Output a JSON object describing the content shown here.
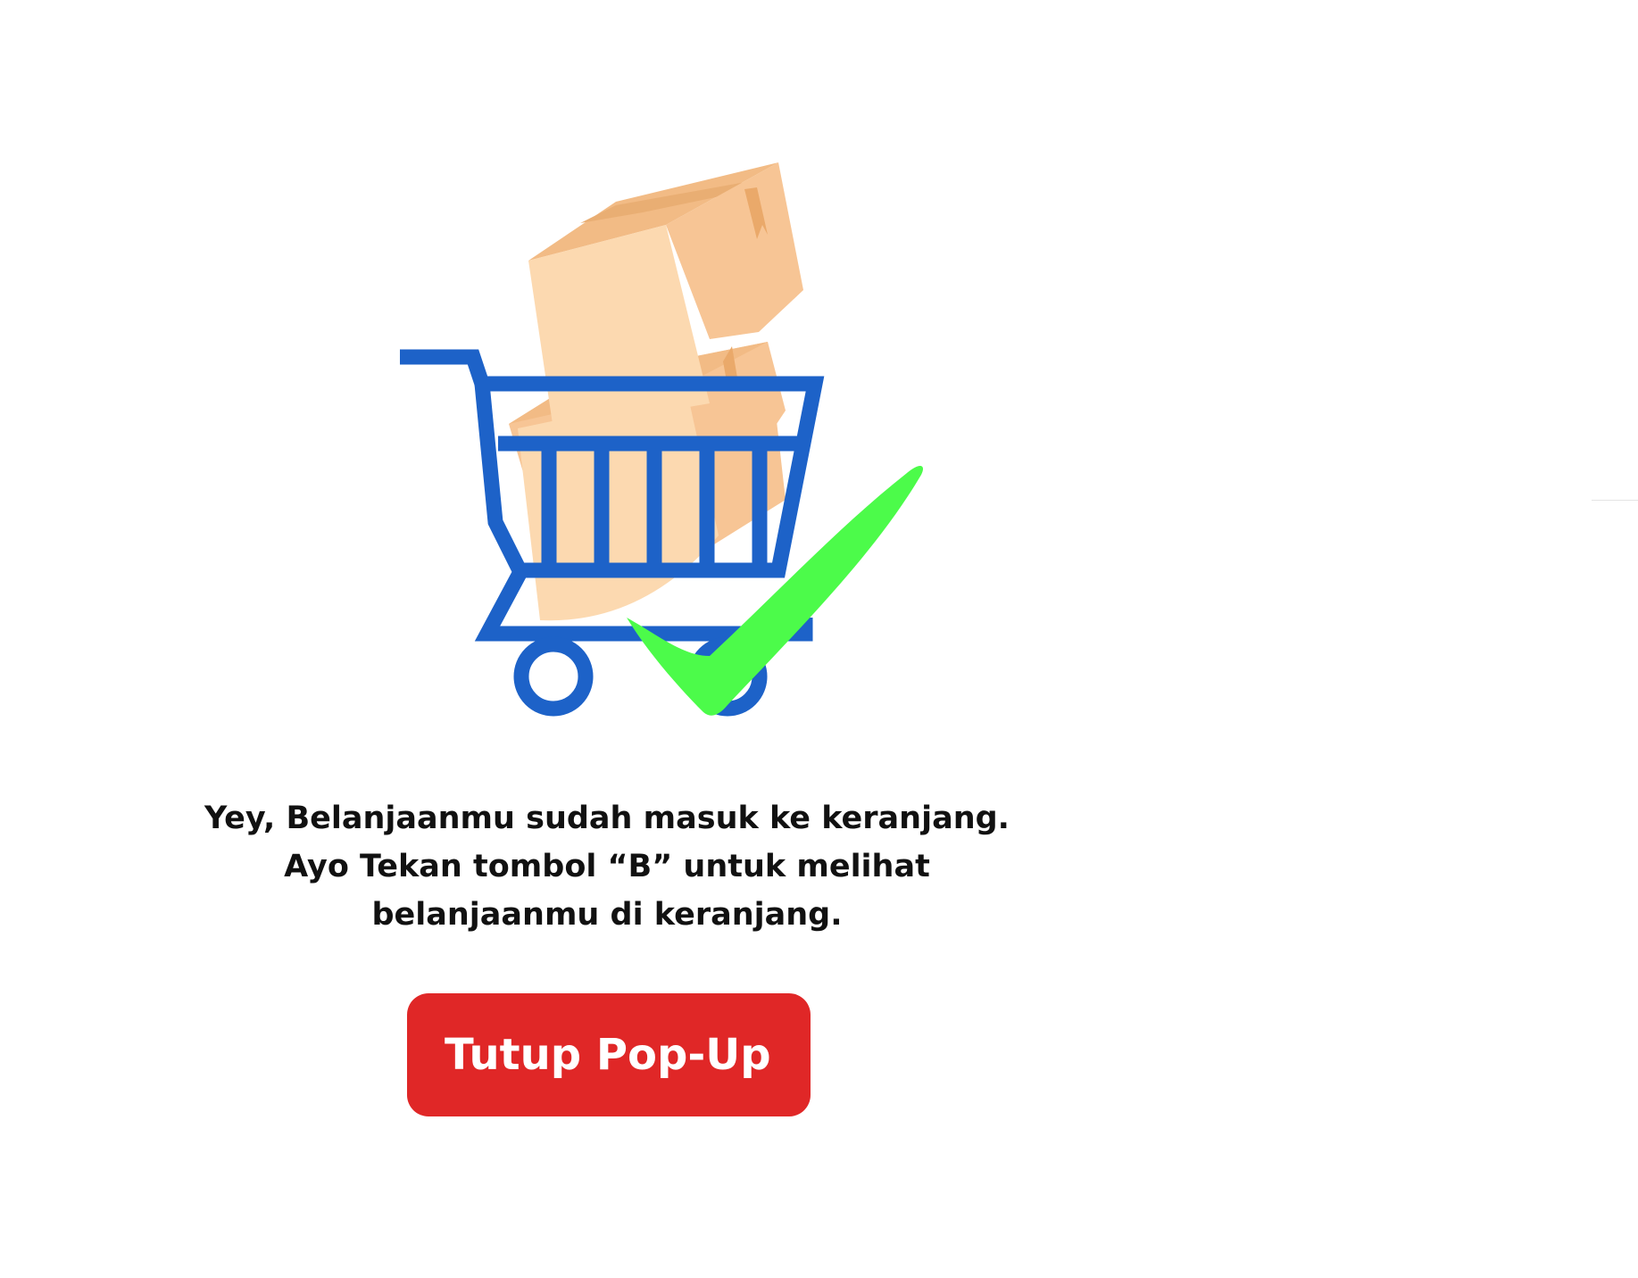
{
  "popup": {
    "message": "Yey, Belanjaanmu sudah masuk ke keranjang. Ayo Tekan tombol “B” untuk melihat belanjaanmu di keranjang.",
    "close_button_label": "Tutup Pop-Up"
  },
  "illustration": {
    "icon": "shopping-cart-with-boxes-and-checkmark",
    "colors": {
      "cart": "#1d62c8",
      "box_front": "#fcd9b0",
      "box_side": "#f7c595",
      "box_top": "#f2bb85",
      "checkmark": "#4cfb4a"
    }
  },
  "colors": {
    "button": "#e02727",
    "button_text": "#ffffff",
    "text": "#111111",
    "background": "#ffffff"
  }
}
